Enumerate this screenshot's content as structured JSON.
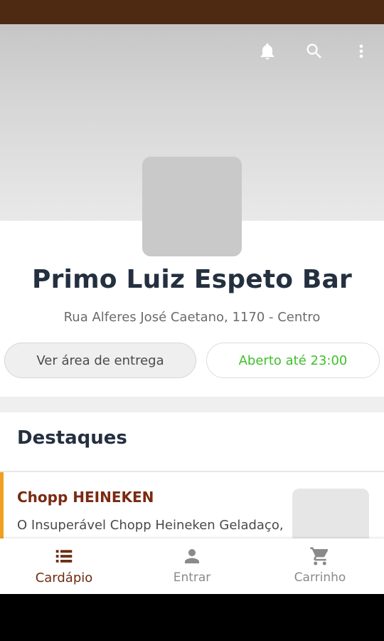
{
  "colors": {
    "status_bar": "#4e2a12",
    "brand_dark": "#6b2e12",
    "item_title": "#7a2a12",
    "open_green": "#3fbf2a",
    "accent_orange": "#f0a020",
    "inactive_gray": "#8a8a8a"
  },
  "header": {
    "icons": [
      "bell-icon",
      "search-icon",
      "more-vert-icon"
    ]
  },
  "store": {
    "name": "Primo Luiz Espeto Bar",
    "address": "Rua Alferes José Caetano, 1170 - Centro",
    "delivery_area_label": "Ver área de entrega",
    "open_status": "Aberto até 23:00"
  },
  "highlights": {
    "title": "Destaques",
    "items": [
      {
        "name": "Chopp HEINEKEN",
        "description": "O Insuperável Chopp Heineken Geladaço,"
      }
    ]
  },
  "bottom_nav": {
    "items": [
      {
        "label": "Cardápio",
        "icon": "menu-list-icon",
        "active": true
      },
      {
        "label": "Entrar",
        "icon": "person-icon",
        "active": false
      },
      {
        "label": "Carrinho",
        "icon": "cart-icon",
        "active": false
      }
    ]
  }
}
